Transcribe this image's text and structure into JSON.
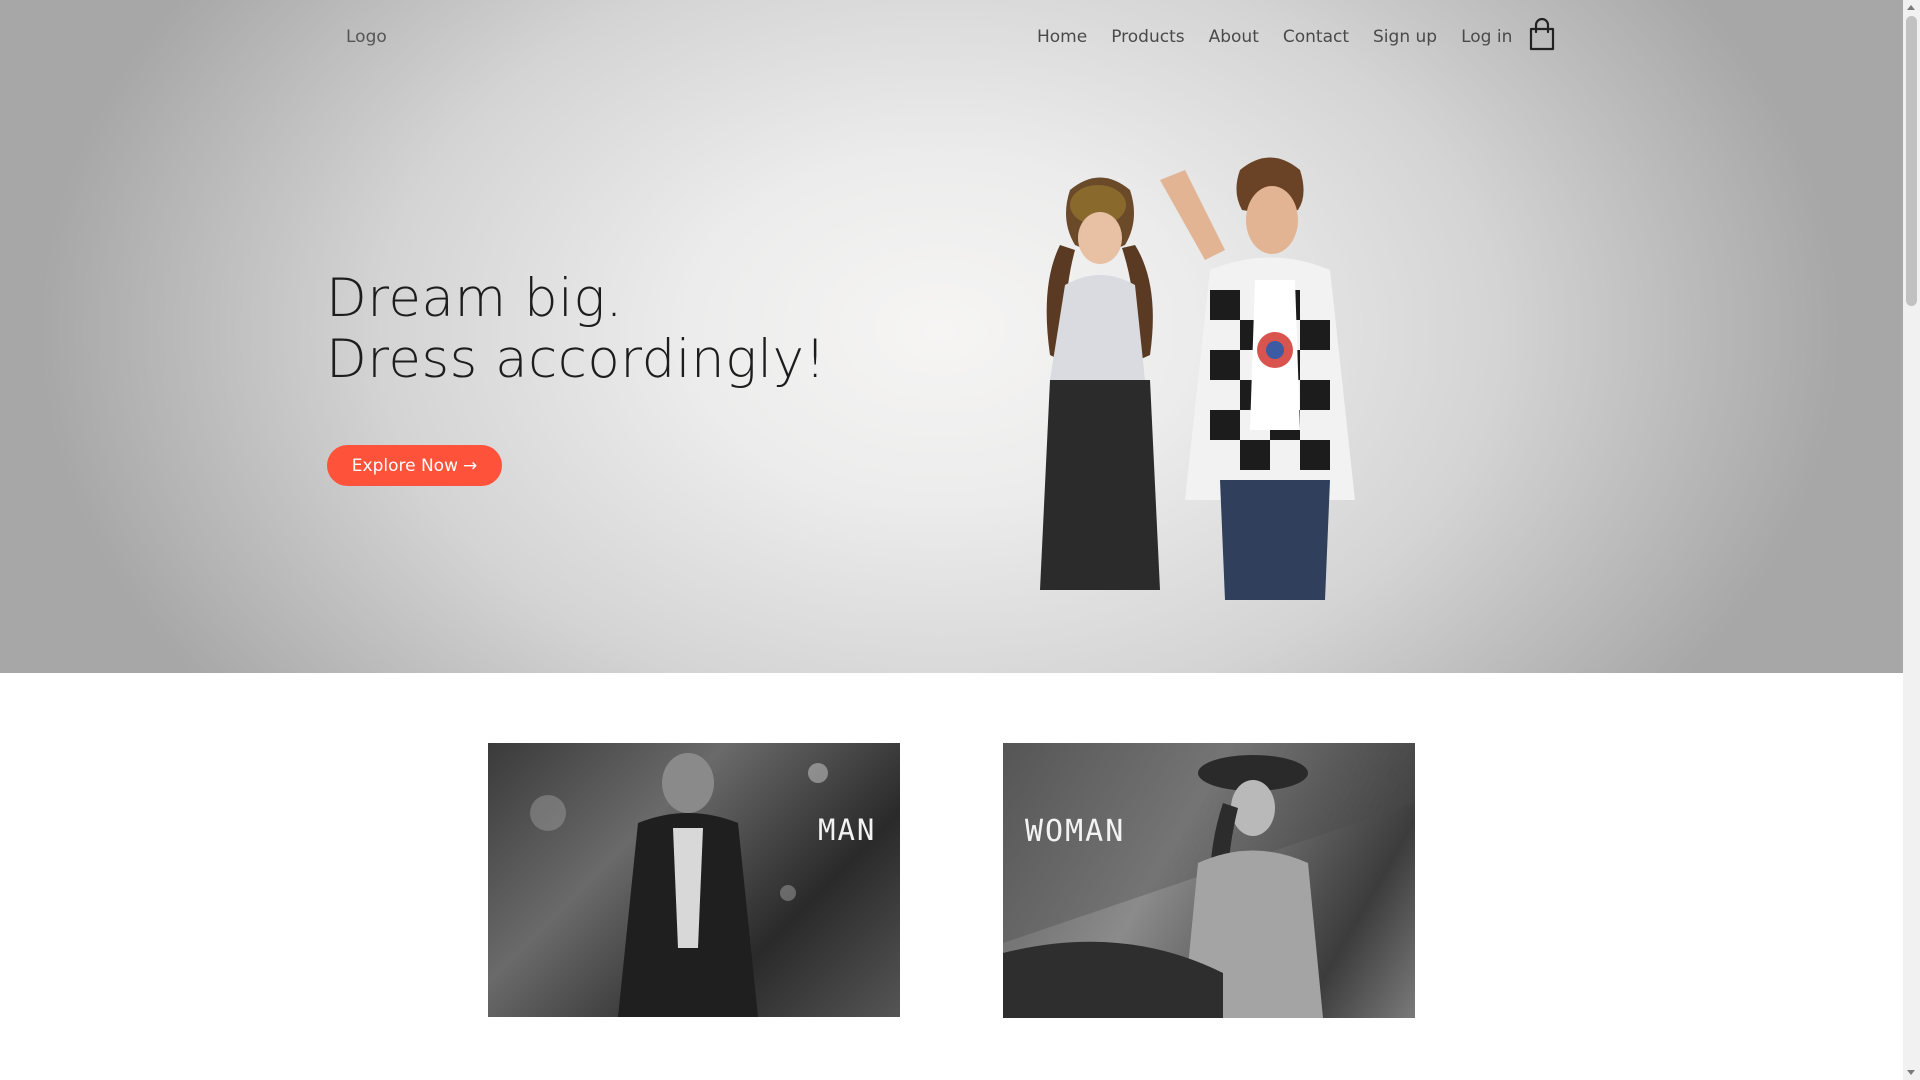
{
  "navbar": {
    "logo": "Logo",
    "links": [
      "Home",
      "Products",
      "About",
      "Contact",
      "Sign up",
      "Log in"
    ],
    "cart_icon": "shopping-bag-icon"
  },
  "hero": {
    "headline_line1": "Dream big.",
    "headline_line2": "Dress accordingly!",
    "cta_label": "Explore Now",
    "cta_arrow": "→",
    "accent_color": "#ff523b"
  },
  "categories": [
    {
      "label": "MAN"
    },
    {
      "label": "WOMAN"
    }
  ]
}
